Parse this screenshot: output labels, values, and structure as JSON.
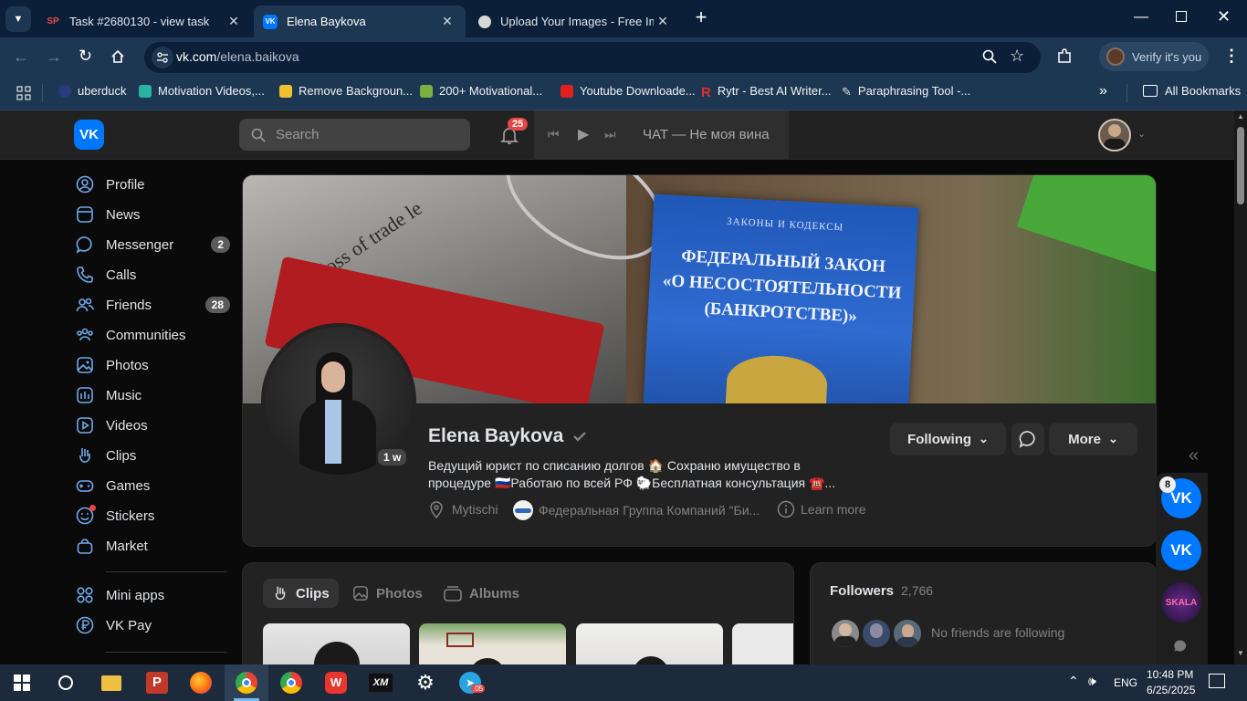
{
  "browser": {
    "tabs": [
      {
        "title": "Task #2680130 - view task",
        "favicon": "SP"
      },
      {
        "title": "Elena Baykova",
        "favicon": "VK"
      },
      {
        "title": "Upload Your Images - Free Imag",
        "favicon": "img"
      }
    ],
    "url_host": "vk.com",
    "url_path": "/elena.baikova",
    "verify_label": "Verify it's you",
    "bookmarks": [
      "uberduck",
      "Motivation Videos,...",
      "Remove Backgroun...",
      "200+ Motivational...",
      "Youtube Downloade...",
      "Rytr - Best AI Writer...",
      "Paraphrasing Tool -..."
    ],
    "all_bookmarks": "All Bookmarks"
  },
  "header": {
    "search_placeholder": "Search",
    "notifications_count": "25",
    "player_track": "ЧАТ — Не моя вина"
  },
  "sidebar": {
    "items": [
      {
        "label": "Profile",
        "icon": "profile-icon"
      },
      {
        "label": "News",
        "icon": "news-icon"
      },
      {
        "label": "Messenger",
        "icon": "messenger-icon",
        "count": "2"
      },
      {
        "label": "Calls",
        "icon": "phone-icon"
      },
      {
        "label": "Friends",
        "icon": "friends-icon",
        "count": "28"
      },
      {
        "label": "Communities",
        "icon": "communities-icon"
      },
      {
        "label": "Photos",
        "icon": "photos-icon"
      },
      {
        "label": "Music",
        "icon": "music-icon"
      },
      {
        "label": "Videos",
        "icon": "videos-icon"
      },
      {
        "label": "Clips",
        "icon": "clips-icon"
      },
      {
        "label": "Games",
        "icon": "gamepad-icon"
      },
      {
        "label": "Stickers",
        "icon": "stickers-icon"
      },
      {
        "label": "Market",
        "icon": "market-icon"
      }
    ],
    "extra": [
      {
        "label": "Mini apps",
        "icon": "apps-icon"
      },
      {
        "label": "VK Pay",
        "icon": "vkpay-icon"
      }
    ]
  },
  "cover": {
    "book_series": "ЗАКОНЫ И КОДЕКСЫ",
    "book_line1": "ФЕДЕРАЛЬНЫЙ ЗАКОН",
    "book_line2": "«О НЕСОСТОЯТЕЛЬНОСТИ",
    "book_line3": "(БАНКРОТСТВЕ)»",
    "newspaper_text": "ard by loss of trade le"
  },
  "profile": {
    "name": "Elena Baykova",
    "story_badge": "1 w",
    "status_line1": "Ведущий юрист по списанию долгов 🏠 Сохраню имущество в",
    "status_line2": "процедуре 🇷🇺Работаю по всей РФ 🐑Бесплатная консультация ☎️...",
    "location": "Mytischi",
    "company": "Федеральная Группа Компаний \"Би...",
    "learn_more": "Learn more",
    "following_label": "Following",
    "more_label": "More"
  },
  "media_tabs": [
    "Clips",
    "Photos",
    "Albums"
  ],
  "followers": {
    "title": "Followers",
    "count": "2,766",
    "note": "No friends are following"
  },
  "right_rail": {
    "badge": "8",
    "skala_label": "SKALA"
  },
  "taskbar": {
    "lang": "ENG",
    "time": "10:48 PM",
    "date": "6/25/2025",
    "telegram_badge": ".05"
  },
  "colors": {
    "accent": "#71aaeb",
    "vk_blue": "#0077ff",
    "bg": "#0a0a0a",
    "card": "#222222",
    "notify_red": "#e64646"
  }
}
